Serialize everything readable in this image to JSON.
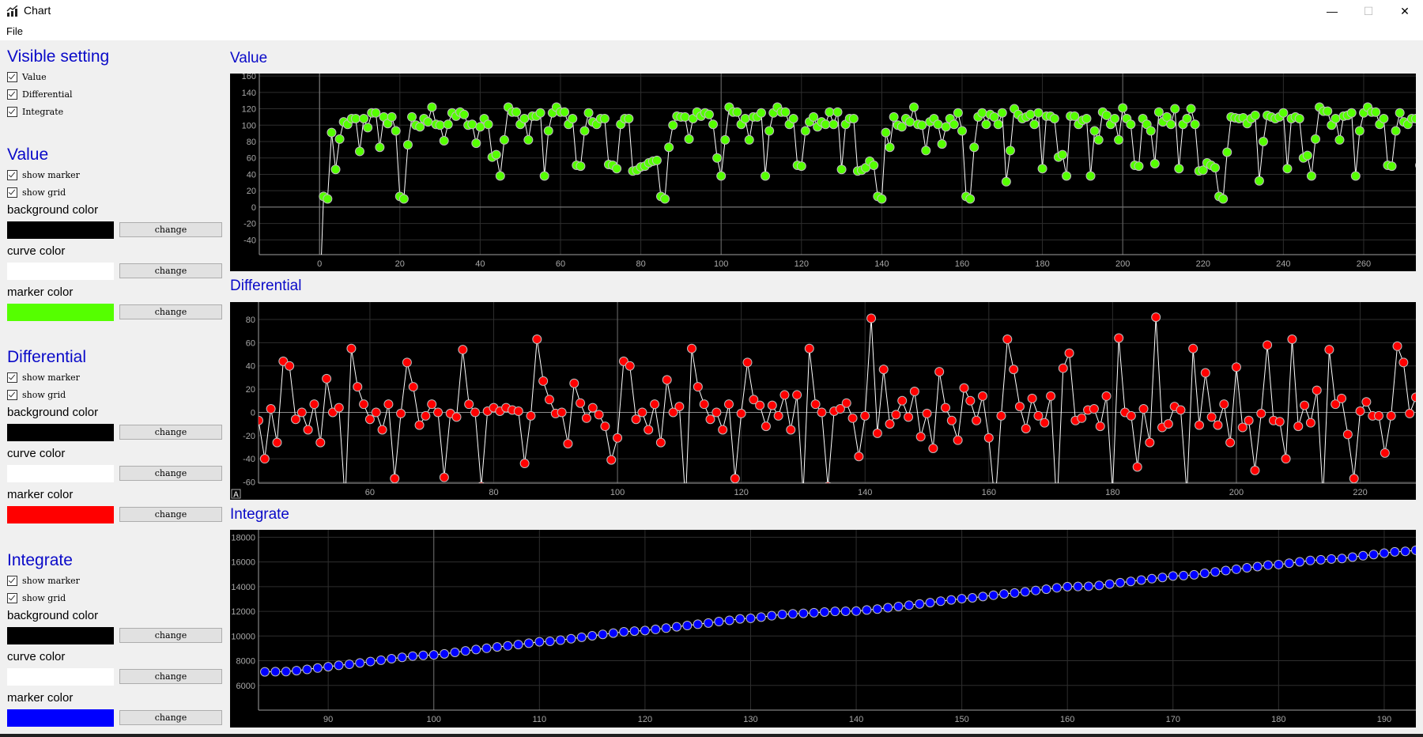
{
  "window": {
    "title": "Chart",
    "minimize_glyph": "—",
    "maximize_glyph": "☐",
    "close_glyph": "✕"
  },
  "menu": {
    "items": [
      "File"
    ]
  },
  "sidebar": {
    "visible_setting": {
      "title": "Visible setting",
      "options": [
        {
          "label": "Value",
          "checked": true
        },
        {
          "label": "Differential",
          "checked": true
        },
        {
          "label": "Integrate",
          "checked": true
        }
      ]
    },
    "sections": [
      {
        "title": "Value",
        "show_marker_label": "show marker",
        "show_marker": true,
        "show_grid_label": "show grid",
        "show_grid": true,
        "background_color_label": "background color",
        "background_color": "#000000",
        "curve_color_label": "curve color",
        "curve_color": "#ffffff",
        "marker_color_label": "marker color",
        "marker_color": "#55ff00",
        "change_label": "change"
      },
      {
        "title": "Differential",
        "show_marker_label": "show marker",
        "show_marker": true,
        "show_grid_label": "show grid",
        "show_grid": true,
        "background_color_label": "background color",
        "background_color": "#000000",
        "curve_color_label": "curve color",
        "curve_color": "#ffffff",
        "marker_color_label": "marker color",
        "marker_color": "#ff0000",
        "change_label": "change"
      },
      {
        "title": "Integrate",
        "show_marker_label": "show marker",
        "show_marker": true,
        "show_grid_label": "show grid",
        "show_grid": true,
        "background_color_label": "background color",
        "background_color": "#000000",
        "curve_color_label": "curve color",
        "curve_color": "#ffffff",
        "marker_color_label": "marker color",
        "marker_color": "#0000ff",
        "change_label": "change"
      }
    ]
  },
  "chart_data": [
    {
      "type": "line",
      "title": "Value",
      "xlabel": "",
      "ylabel": "",
      "xlim": [
        -15,
        273
      ],
      "ylim": [
        -58,
        163
      ],
      "xticks": [
        0,
        20,
        40,
        60,
        80,
        100,
        120,
        140,
        160,
        180,
        200,
        220,
        240,
        260
      ],
      "yticks": [
        -40,
        -20,
        0,
        20,
        40,
        60,
        80,
        100,
        120,
        140,
        160
      ],
      "grid": true,
      "marker_color": "#55ff00",
      "curve_color": "#ffffff",
      "background": "#000000",
      "x_start": 0,
      "values": [
        -120,
        13,
        10,
        91,
        46,
        83,
        104,
        101,
        108,
        108,
        68,
        108,
        97,
        115,
        115,
        73,
        110,
        102,
        110,
        93,
        13,
        10,
        76,
        110,
        100,
        98,
        108,
        104,
        122,
        101,
        100,
        81,
        101,
        115,
        111,
        116,
        113,
        100,
        101,
        78,
        98,
        108,
        101,
        61,
        64,
        38,
        82,
        122,
        116,
        116,
        101,
        108,
        82,
        111,
        111,
        115,
        38,
        93,
        115,
        122,
        116,
        116,
        101,
        108,
        51,
        50,
        93,
        115,
        104,
        101,
        108,
        108,
        52,
        51,
        47,
        101,
        108,
        108,
        44,
        45,
        49,
        50,
        54,
        56,
        57,
        13,
        10,
        73,
        100,
        111,
        110,
        110,
        83,
        108,
        116,
        111,
        115,
        113,
        101,
        60,
        38,
        82,
        122,
        116,
        116,
        101,
        108,
        82,
        110,
        110,
        115,
        38,
        93,
        115,
        122,
        116,
        116,
        101,
        108,
        51,
        50,
        93,
        104,
        110,
        98,
        104,
        101,
        116,
        101,
        116,
        46,
        101,
        108,
        108,
        44,
        45,
        48,
        56,
        51,
        13,
        10,
        91,
        73,
        110,
        100,
        98,
        108,
        104,
        122,
        101,
        100,
        69,
        104,
        108,
        101,
        77,
        98,
        108,
        101,
        115,
        93,
        13,
        10,
        73,
        110,
        115,
        101,
        113,
        110,
        101,
        115,
        31,
        69,
        120,
        113,
        108,
        110,
        113,
        101,
        115,
        47,
        111,
        111,
        108,
        61,
        64,
        38,
        111,
        111,
        101,
        106,
        108,
        38,
        93,
        82,
        116,
        112,
        101,
        108,
        82,
        121,
        108,
        101,
        51,
        50,
        108,
        101,
        93,
        53,
        116,
        104,
        110,
        101,
        120,
        47,
        101,
        108,
        120,
        101,
        44,
        45,
        54,
        51,
        48,
        13,
        10,
        67,
        110,
        109,
        108,
        109,
        102,
        108,
        112,
        32,
        80,
        112,
        110,
        108,
        110,
        115,
        47,
        108,
        110,
        108,
        60,
        63,
        38,
        83,
        122,
        117,
        117,
        100,
        108,
        82,
        111,
        112,
        115,
        38,
        93,
        115,
        122,
        116,
        116,
        101,
        108,
        51,
        50,
        93,
        115,
        104,
        101,
        108,
        108,
        51
      ]
    },
    {
      "type": "line",
      "title": "Differential",
      "xlabel": "",
      "ylabel": "",
      "xlim": [
        42,
        229
      ],
      "ylim": [
        -61,
        95
      ],
      "xticks": [
        60,
        80,
        100,
        120,
        140,
        160,
        180,
        200,
        220
      ],
      "yticks": [
        -60,
        -40,
        -20,
        0,
        20,
        40,
        60,
        80
      ],
      "grid": true,
      "marker_color": "#ff0000",
      "curve_color": "#ffffff",
      "background": "#000000",
      "corner_badge": "A",
      "x_start": 42,
      "values": [
        -7,
        -40,
        3,
        -26,
        44,
        40,
        -6,
        0,
        -15,
        7,
        -26,
        29,
        0,
        4,
        -77,
        55,
        22,
        7,
        -6,
        0,
        -15,
        7,
        -57,
        -1,
        43,
        22,
        -11,
        -3,
        7,
        0,
        -56,
        -1,
        -4,
        54,
        7,
        0,
        -64,
        1,
        4,
        1,
        4,
        2,
        1,
        -44,
        -3,
        63,
        27,
        11,
        -1,
        0,
        -27,
        25,
        8,
        -5,
        4,
        -2,
        -12,
        -41,
        -22,
        44,
        40,
        -6,
        0,
        -15,
        7,
        -26,
        28,
        0,
        5,
        -77,
        55,
        22,
        7,
        -6,
        0,
        -15,
        7,
        -57,
        -1,
        43,
        11,
        6,
        -12,
        6,
        -3,
        15,
        -15,
        15,
        -70,
        55,
        7,
        0,
        -64,
        1,
        3,
        8,
        -5,
        -38,
        -3,
        81,
        -18,
        37,
        -10,
        -2,
        10,
        -4,
        18,
        -21,
        -1,
        -31,
        35,
        4,
        -7,
        -24,
        21,
        10,
        -7,
        14,
        -22,
        -80,
        -3,
        63,
        37,
        5,
        -14,
        12,
        -3,
        -9,
        14,
        -84,
        38,
        51,
        -7,
        -5,
        2,
        3,
        -12,
        14,
        -68,
        64,
        0,
        -3,
        -47,
        3,
        -26,
        82,
        -13,
        -10,
        5,
        2,
        -70,
        55,
        -11,
        34,
        -4,
        -11,
        7,
        -26,
        39,
        -13,
        -7,
        -50,
        -1,
        58,
        -7,
        -8,
        -40,
        63,
        -12,
        6,
        -9,
        19,
        -73,
        54,
        7,
        12,
        -19,
        -57,
        1,
        9,
        -3,
        -3,
        -35,
        -3,
        57,
        43,
        -1,
        13
      ]
    },
    {
      "type": "line",
      "title": "Integrate",
      "xlabel": "",
      "ylabel": "",
      "xlim": [
        83.4,
        193
      ],
      "ylim": [
        4000,
        18600
      ],
      "xticks": [
        90,
        100,
        110,
        120,
        130,
        140,
        150,
        160,
        170,
        180,
        190
      ],
      "yticks": [
        6000,
        8000,
        10000,
        12000,
        14000,
        16000,
        18000
      ],
      "grid": true,
      "marker_color": "#0000ff",
      "curve_color": "#ffffff",
      "background": "#000000",
      "x_start": 84,
      "values": [
        7100,
        7113,
        7123,
        7196,
        7296,
        7407,
        7517,
        7627,
        7710,
        7818,
        7934,
        8045,
        8160,
        8273,
        8374,
        8434,
        8472,
        8554,
        8676,
        8792,
        8908,
        9009,
        9117,
        9199,
        9309,
        9419,
        9534,
        9572,
        9665,
        9780,
        9902,
        10018,
        10134,
        10235,
        10343,
        10394,
        10444,
        10537,
        10641,
        10751,
        10849,
        10953,
        11054,
        11170,
        11271,
        11387,
        11433,
        11534,
        11642,
        11750,
        11794,
        11839,
        11887,
        11943,
        11994,
        12007,
        12017,
        12108,
        12181,
        12291,
        12391,
        12489,
        12597,
        12701,
        12823,
        12924,
        13024,
        13093,
        13197,
        13305,
        13406,
        13483,
        13581,
        13689,
        13790,
        13905,
        13998,
        14011,
        14021,
        14094,
        14204,
        14319,
        14420,
        14533,
        14643,
        14744,
        14859,
        14890,
        14959,
        15079,
        15192,
        15300,
        15410,
        15523,
        15624,
        15739,
        15786,
        15897,
        16008,
        16116,
        16177,
        16241,
        16279,
        16390,
        16501,
        16602,
        16708,
        16816,
        16854,
        16947
      ]
    }
  ]
}
